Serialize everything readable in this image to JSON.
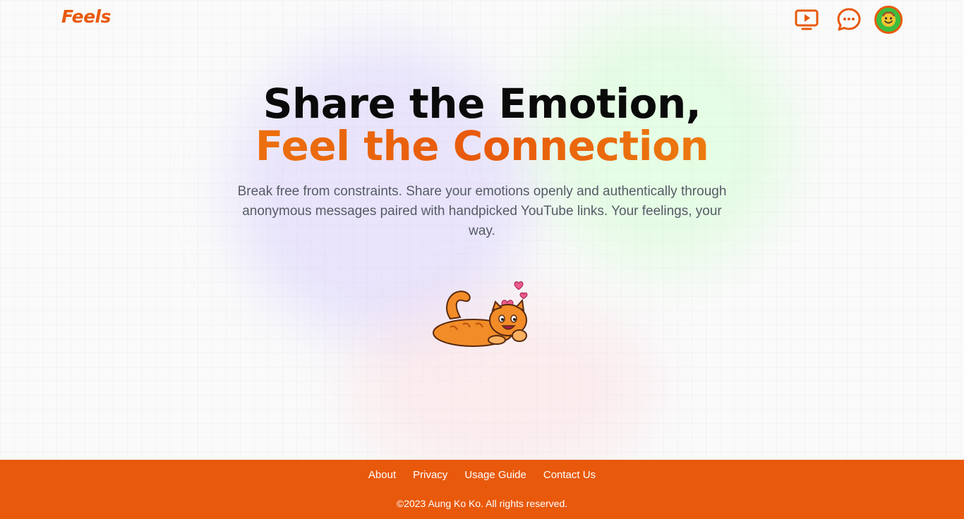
{
  "header": {
    "logo": "Feels",
    "icons": [
      "video-play-icon",
      "chat-bubble-icon",
      "avatar"
    ]
  },
  "hero": {
    "line1": "Share the Emotion,",
    "line2": "Feel the Connection",
    "description": "Break free from constraints. Share your emotions openly and authentically through anonymous messages paired with handpicked YouTube links. Your feelings, your way."
  },
  "footer": {
    "links": [
      "About",
      "Privacy",
      "Usage Guide",
      "Contact Us"
    ],
    "copyright": "©2023 Aung Ko Ko. All rights reserved."
  },
  "colors": {
    "accent": "#e8590c",
    "text_dark": "#0a0a0a",
    "text_muted": "#555b66",
    "avatar_bg": "#3ebd3e"
  }
}
